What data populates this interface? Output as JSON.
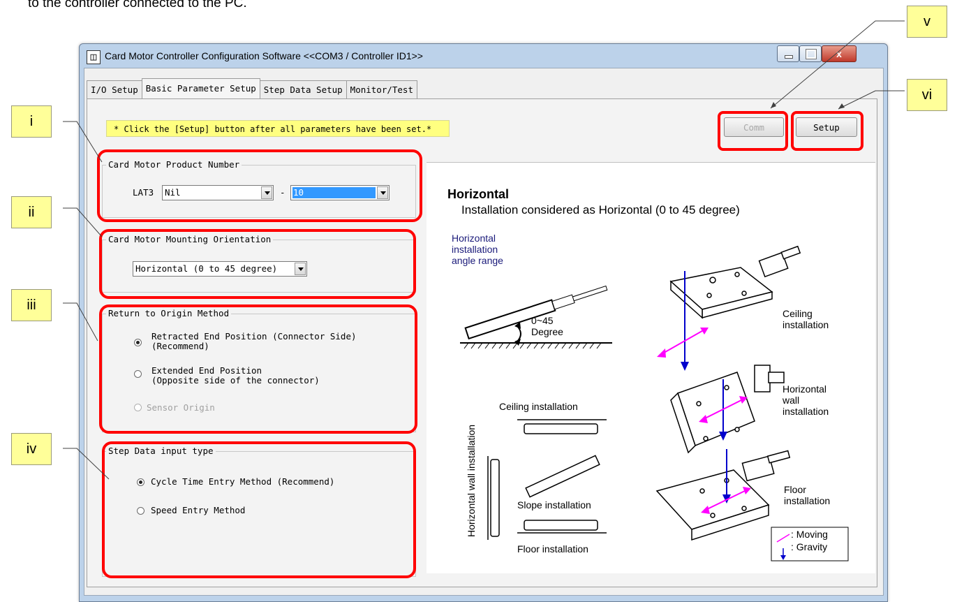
{
  "intro_text": "to the controller connected to the PC.",
  "window": {
    "title": "Card Motor Controller Configuration Software <<COM3 / Controller ID1>>",
    "icon": "app-icon",
    "close_glyph": "x"
  },
  "tabs": [
    {
      "label": "I/O Setup"
    },
    {
      "label": "Basic Parameter Setup"
    },
    {
      "label": "Step Data Setup"
    },
    {
      "label": "Monitor/Test"
    }
  ],
  "hint": "* Click the [Setup] button after all parameters have been set.*",
  "buttons": {
    "comm": "Comm",
    "setup": "Setup"
  },
  "product_number": {
    "label": "Card Motor Product Number",
    "prefix": "LAT3",
    "combo1": "Nil",
    "separator": "-",
    "combo2": "10"
  },
  "mounting": {
    "label": "Card Motor Mounting Orientation",
    "value": "Horizontal (0 to 45 degree)"
  },
  "origin": {
    "label": "Return to Origin Method",
    "options": [
      {
        "line1": "Retracted End Position (Connector Side)",
        "line2": "(Recommend)",
        "selected": true
      },
      {
        "line1": "Extended End Position",
        "line2": "(Opposite side of the connector)",
        "selected": false
      },
      {
        "line1": "Sensor Origin",
        "line2": "",
        "selected": false,
        "disabled": true
      }
    ]
  },
  "step_input": {
    "label": "Step Data input type",
    "options": [
      {
        "text": "Cycle Time Entry Method (Recommend)",
        "selected": true
      },
      {
        "text": "Speed Entry Method",
        "selected": false
      }
    ]
  },
  "callouts": [
    "i",
    "ii",
    "iii",
    "iv",
    "v",
    "vi"
  ],
  "illustration": {
    "heading": "Horizontal",
    "subheading": "Installation considered as Horizontal (0 to 45 degree)",
    "angle_label_1": "Horizontal",
    "angle_label_2": "installation",
    "angle_label_3": "angle range",
    "angle_value_1": "0~45",
    "angle_value_2": "Degree",
    "ceiling_right_1": "Ceiling",
    "ceiling_right_2": "installation",
    "wall_right_1": "Horizontal",
    "wall_right_2": "wall",
    "wall_right_3": "installation",
    "floor_right_1": "Floor",
    "floor_right_2": "installation",
    "vertical_label": "Horizontal wall installation",
    "ceiling_small": "Ceiling installation",
    "slope_small": "Slope installation",
    "floor_small": "Floor installation",
    "legend_moving": ": Moving",
    "legend_gravity": ": Gravity",
    "moving_color": "#ff00ff",
    "gravity_color": "#0000cc"
  },
  "colors": {
    "highlight": "#ff0000",
    "callout_bg": "#ffff99",
    "hint_bg": "#ffff80"
  }
}
